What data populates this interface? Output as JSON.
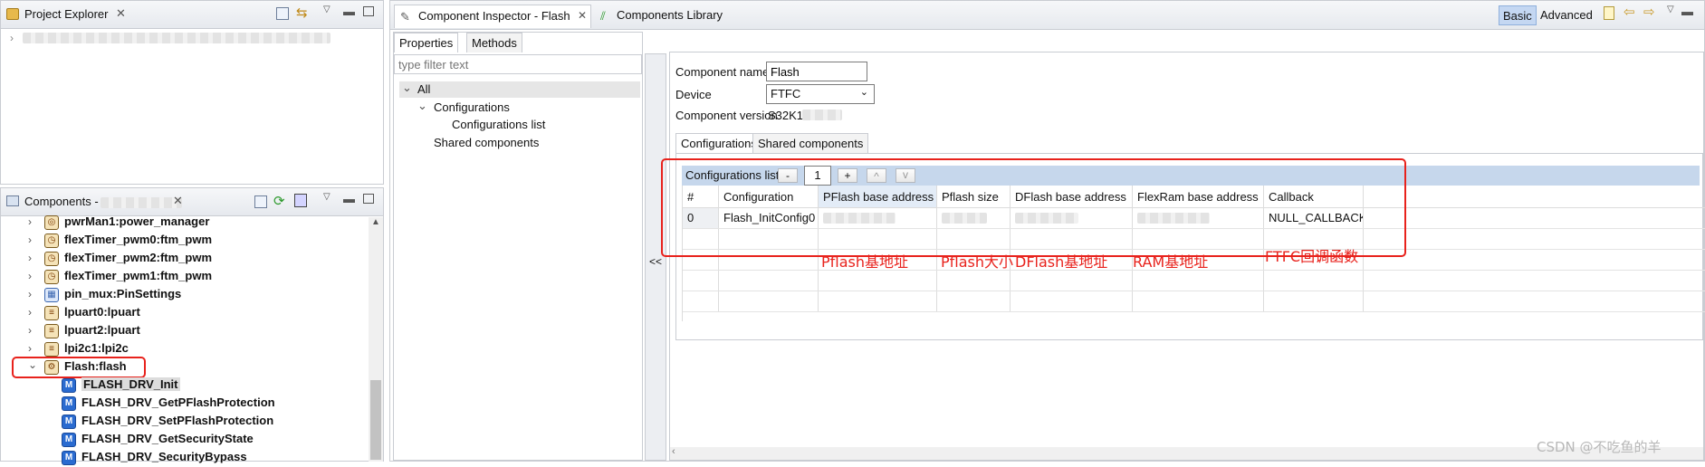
{
  "project_explorer": {
    "title": "Project Explorer"
  },
  "components_view": {
    "title": "Components - ",
    "items": [
      {
        "label": "pwrMan1:power_manager"
      },
      {
        "label": "flexTimer_pwm0:ftm_pwm"
      },
      {
        "label": "flexTimer_pwm2:ftm_pwm"
      },
      {
        "label": "flexTimer_pwm1:ftm_pwm"
      },
      {
        "label": "pin_mux:PinSettings"
      },
      {
        "label": "lpuart0:lpuart"
      },
      {
        "label": "lpuart2:lpuart"
      },
      {
        "label": "lpi2c1:lpi2c"
      },
      {
        "label": "Flash:flash"
      }
    ],
    "functions": [
      {
        "label": "FLASH_DRV_Init"
      },
      {
        "label": "FLASH_DRV_GetPFlashProtection"
      },
      {
        "label": "FLASH_DRV_SetPFlashProtection"
      },
      {
        "label": "FLASH_DRV_GetSecurityState"
      },
      {
        "label": "FLASH_DRV_SecurityBypass"
      }
    ]
  },
  "editor_tabs": [
    {
      "label": "Component Inspector - Flash"
    },
    {
      "label": "Components Library"
    }
  ],
  "mode_buttons": {
    "basic": "Basic",
    "advanced": "Advanced"
  },
  "inspector": {
    "sub_tabs": [
      "Properties",
      "Methods"
    ],
    "filter_placeholder": "type filter text",
    "tree": {
      "all": "All",
      "configurations": "Configurations",
      "configurations_list": "Configurations list",
      "shared": "Shared components"
    },
    "collapse_label": "<<",
    "component_name_label": "Component name",
    "component_name_value": "Flash",
    "device_label": "Device",
    "device_value": "FTFC",
    "version_label": "Component version",
    "version_value": "S32K1",
    "config_tabs": [
      "Configurations",
      "Shared components"
    ],
    "config_list": {
      "title": "Configurations list",
      "minus": "-",
      "index": "1",
      "plus": "+",
      "up": "^",
      "down": "v",
      "columns": [
        "#",
        "Configuration",
        "PFlash base address",
        "Pflash size",
        "DFlash base address",
        "FlexRam base address",
        "Callback"
      ],
      "rows": [
        [
          "0",
          "Flash_InitConfig0",
          "",
          "",
          "",
          "",
          "NULL_CALLBACK"
        ]
      ]
    }
  },
  "annotations": [
    "Pflash基地址",
    "Pflash大小",
    "DFlash基地址",
    "RAM基地址",
    "FTFC回调函数"
  ],
  "watermark": "CSDN @不吃鱼的羊",
  "colors": {
    "annotation": "#e8221c",
    "header": "#c6d7ec",
    "basic_active": "#c4d7f2"
  }
}
